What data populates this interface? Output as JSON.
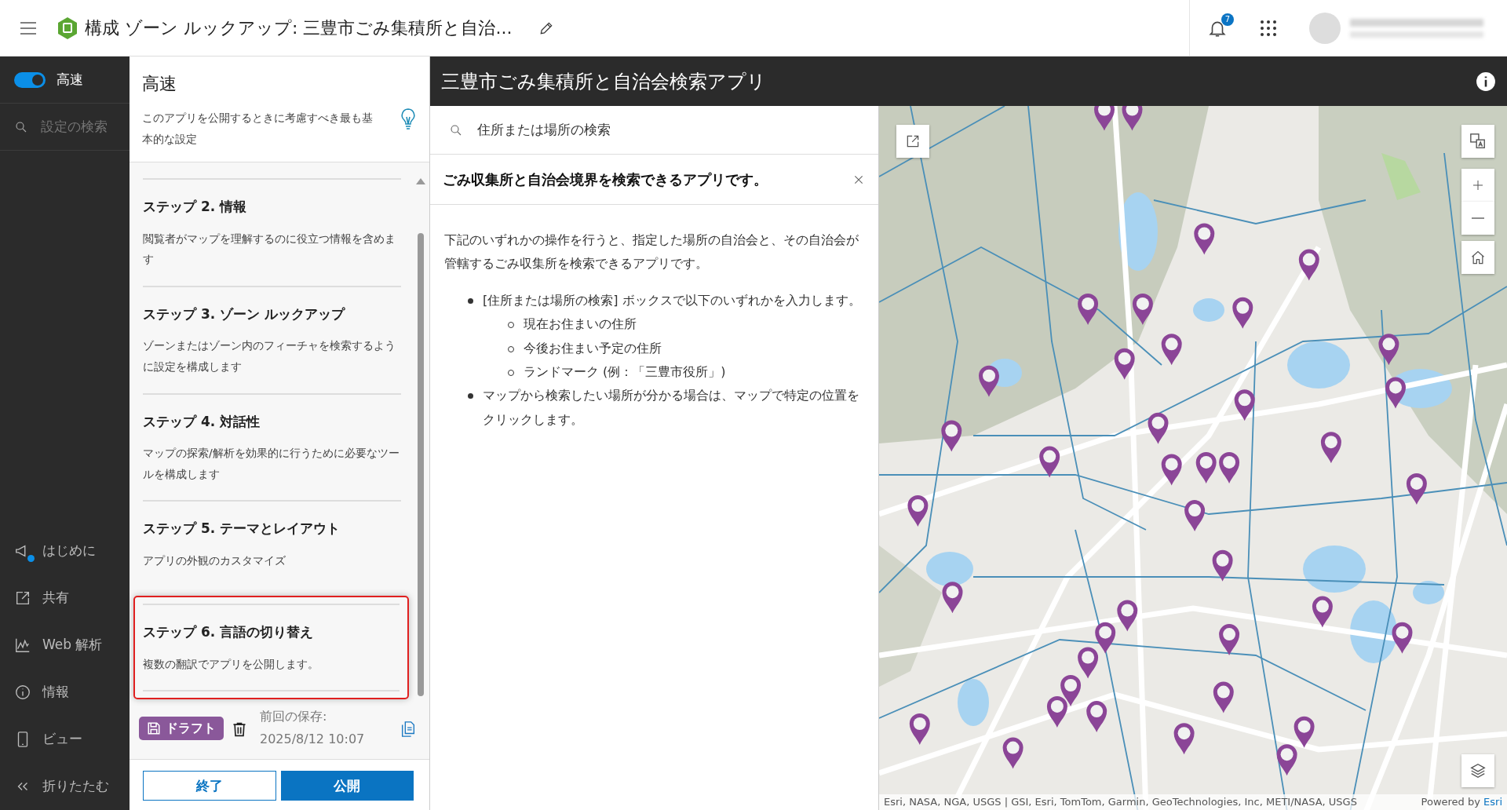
{
  "topbar": {
    "title": "構成 ゾーン ルックアップ: 三豊市ごみ集積所と自治...",
    "notification_count": "7"
  },
  "sidebar": {
    "toggle": {
      "label": "高速",
      "on": true
    },
    "search": {
      "placeholder": "設定の検索"
    },
    "items": [
      {
        "label": "はじめに",
        "unread": true
      },
      {
        "label": "共有",
        "unread": false
      },
      {
        "label": "Web 解析",
        "unread": false
      },
      {
        "label": "情報",
        "unread": false
      },
      {
        "label": "ビュー",
        "unread": false
      },
      {
        "label": "折りたたむ",
        "unread": false
      }
    ]
  },
  "settings": {
    "title": "高速",
    "description": "このアプリを公開するときに考慮すべき最も基本的な設定",
    "steps": [
      {
        "title": "ステップ 2. 情報",
        "description": "閲覧者がマップを理解するのに役立つ情報を含めます",
        "highlighted": false
      },
      {
        "title": "ステップ 3. ゾーン ルックアップ",
        "description": "ゾーンまたはゾーン内のフィーチャを検索するように設定を構成します",
        "highlighted": false
      },
      {
        "title": "ステップ 4. 対話性",
        "description": "マップの探索/解析を効果的に行うために必要なツールを構成します",
        "highlighted": false
      },
      {
        "title": "ステップ 5. テーマとレイアウト",
        "description": "アプリの外観のカスタマイズ",
        "highlighted": false
      },
      {
        "title": "ステップ 6. 言語の切り替え",
        "description": "複数の翻訳でアプリを公開します。",
        "highlighted": true
      }
    ],
    "footer": {
      "status": "ドラフト",
      "last_saved_label": "前回の保存:",
      "last_saved": "2025/8/12 10:07"
    },
    "buttons": [
      {
        "label": "終了",
        "kind": "outline"
      },
      {
        "label": "公開",
        "kind": "primary"
      }
    ]
  },
  "app": {
    "title": "三豊市ごみ集積所と自治会検索アプリ",
    "search": {
      "placeholder": "住所または場所の検索"
    },
    "panel": {
      "heading": "ごみ収集所と自治会境界を検索できるアプリです。",
      "intro": "下記のいずれかの操作を行うと、指定した場所の自治会と、その自治会が管轄するごみ収集所を検索できるアプリです。",
      "bullets": [
        {
          "text": "[住所または場所の検索] ボックスで以下のいずれかを入力します。",
          "children": [
            {
              "text": "現在お住まいの住所"
            },
            {
              "text": "今後お住まい予定の住所"
            },
            {
              "text": "ランドマーク (例：「三豊市役所」)"
            }
          ]
        },
        {
          "text": "マップから検索したい場所が分かる場合は、マップで特定の位置をクリックします。"
        }
      ]
    },
    "map": {
      "attribution": "Esri, NASA, NGA, USGS | GSI, Esri, TomTom, Garmin, GeoTechnologies, Inc, METI/NASA, USGS",
      "powered_by": "Powered by",
      "powered_link": "Esri"
    }
  }
}
